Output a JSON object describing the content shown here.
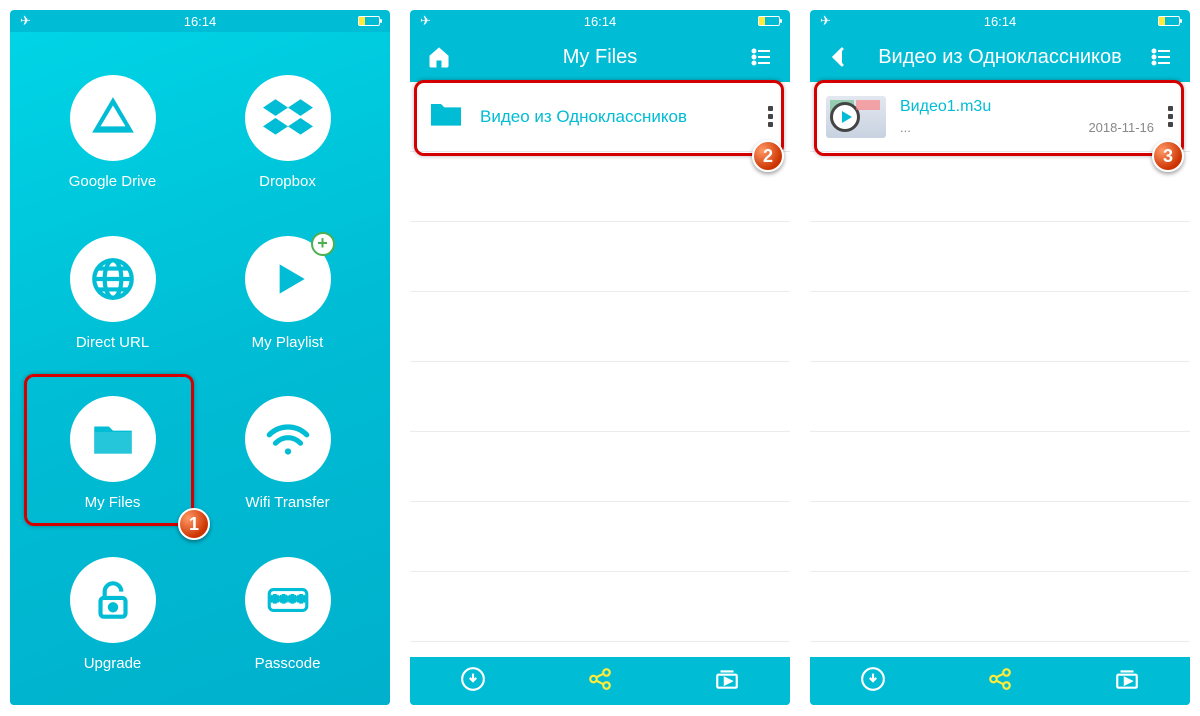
{
  "status": {
    "time": "16:14"
  },
  "screen1": {
    "grid": {
      "google_drive": "Google Drive",
      "dropbox": "Dropbox",
      "direct_url": "Direct URL",
      "my_playlist": "My Playlist",
      "my_files": "My Files",
      "wifi_transfer": "Wifi Transfer",
      "upgrade": "Upgrade",
      "passcode": "Passcode"
    },
    "badge": "1"
  },
  "screen2": {
    "title": "My Files",
    "folder_name": "Видео из Одноклассников",
    "badge": "2"
  },
  "screen3": {
    "title": "Видео из Одноклассников",
    "file": {
      "name": "Видео1.m3u",
      "sub": "...",
      "date": "2018-11-16"
    },
    "badge": "3"
  }
}
